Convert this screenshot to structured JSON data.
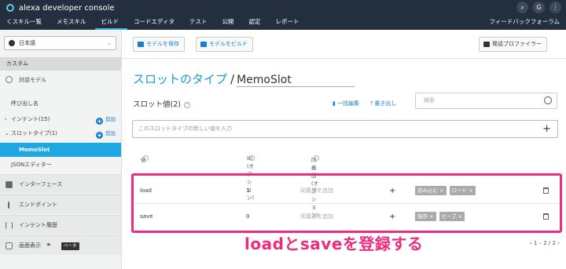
{
  "header": {
    "brand": "alexa developer console",
    "nav": [
      "くスキル一覧",
      "メモスキル",
      "ビルド",
      "コードエディタ",
      "テスト",
      "公開",
      "認定",
      "レポート"
    ],
    "active_tab": "ビルド",
    "feedback": "フィードバックフォーラム",
    "user_initial": "G"
  },
  "sidebar": {
    "locale": "日本語",
    "section": "カスタム",
    "items": [
      {
        "label": "対話モデル"
      },
      {
        "label": "呼び出し名"
      },
      {
        "label": "インテント(15)",
        "add": "追加"
      },
      {
        "label": "スロットタイプ(1)",
        "add": "追加"
      },
      {
        "label": "MemoSlot"
      },
      {
        "label": "JSONエディター"
      },
      {
        "label": "インターフェース"
      },
      {
        "label": "エンドポイント"
      },
      {
        "label": "インテント履歴"
      },
      {
        "label": "画面表示",
        "badge": "ベータ"
      }
    ]
  },
  "toolbar": {
    "save": "モデルを保存",
    "build": "モデルをビルド",
    "profiler": "発話プロファイラー"
  },
  "main": {
    "title": "スロットのタイプ",
    "slot_name": "MemoSlot",
    "values_heading": "スロット値(2)",
    "bulk_edit": "一括編集",
    "export": "書き出し",
    "search_placeholder": "検索",
    "new_value_placeholder": "このスロットタイプの新しい値を入力",
    "columns": {
      "value": "値",
      "id": "ID (オプション)",
      "synonyms": "同義語(オプション)"
    },
    "rows": [
      {
        "value": "load",
        "id": "1",
        "synonym_placeholder": "同義語を追加",
        "synonyms": [
          "読み込む",
          "ロード"
        ]
      },
      {
        "value": "save",
        "id": "0",
        "synonym_placeholder": "同義語を追加",
        "synonyms": [
          "保存",
          "セーブ"
        ]
      }
    ],
    "pagination": "1 – 2 / 2"
  },
  "annotation": "loadとsaveを登録する"
}
